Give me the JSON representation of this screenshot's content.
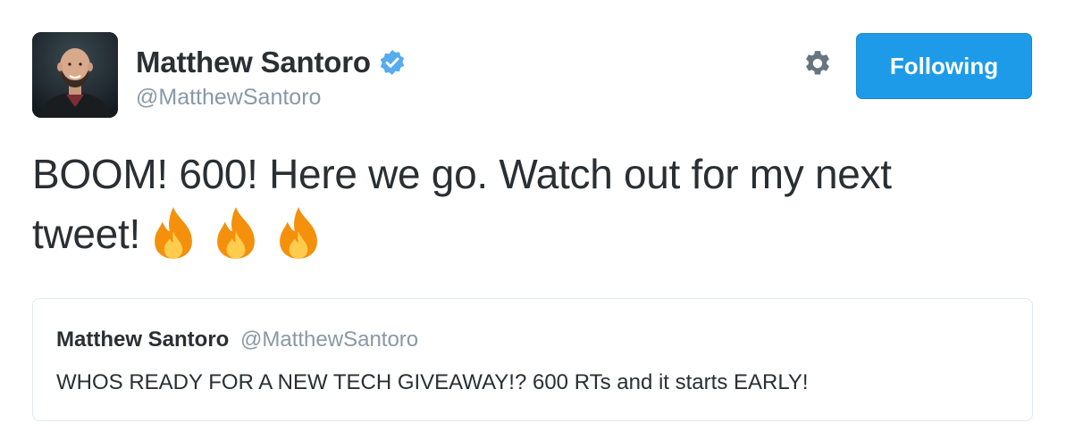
{
  "author": {
    "display_name": "Matthew Santoro",
    "handle": "@MatthewSantoro",
    "verified": true,
    "avatar_icon": "person-avatar"
  },
  "actions": {
    "settings_icon": "gear-icon",
    "follow_button_label": "Following"
  },
  "tweet": {
    "text_line_1": "BOOM! 600! Here we go. Watch out for my next",
    "text_line_2": "tweet!",
    "emoji": [
      "fire-icon",
      "fire-icon",
      "fire-icon"
    ]
  },
  "quoted_tweet": {
    "display_name": "Matthew Santoro",
    "handle": "@MatthewSantoro",
    "text": "WHOS READY FOR A NEW TECH GIVEAWAY!? 600 RTs and it starts EARLY!"
  },
  "colors": {
    "accent": "#1d9be9",
    "verified_badge": "#55acee",
    "text": "#292f33",
    "muted": "#8899a6",
    "border": "#e1e8ed",
    "gear": "#66757f"
  }
}
